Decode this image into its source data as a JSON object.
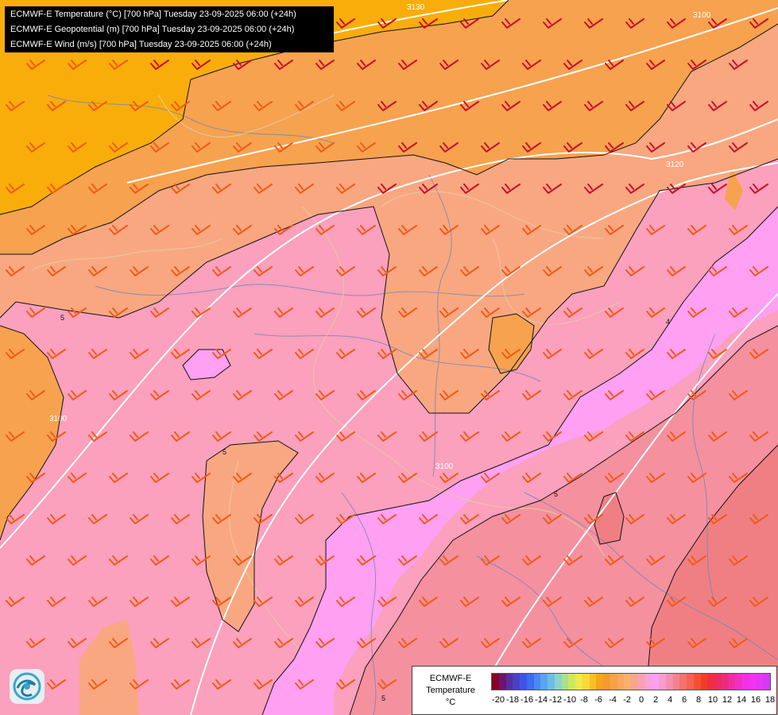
{
  "titles": [
    "ECMWF-E Temperature (°C) [700 hPa] Tuesday 23-09-2025 06:00 (+24h)",
    "ECMWF-E Geopotential (m) [700 hPa] Tuesday 23-09-2025 06:00 (+24h)",
    "ECMWF-E Wind (m/s) [700 hPa] Tuesday 23-09-2025 06:00 (+24h)"
  ],
  "legend": {
    "title_lines": [
      "ECMWF-E",
      "Temperature",
      "°C"
    ],
    "tick_labels": [
      "-20",
      "-18",
      "-16",
      "-14",
      "-12",
      "-10",
      "-8",
      "-6",
      "-4",
      "-2",
      "0",
      "2",
      "4",
      "6",
      "8",
      "10",
      "12",
      "14",
      "16",
      "18"
    ],
    "colors": [
      "#8b0026",
      "#6a1570",
      "#5a2d9e",
      "#4b3fc6",
      "#3c55e6",
      "#3a6df0",
      "#4a88f5",
      "#5aa3f5",
      "#6dbde8",
      "#8ad4c8",
      "#a9e08a",
      "#cde85c",
      "#efe94a",
      "#fbd93a",
      "#f9bf2a",
      "#f7a51a",
      "#f59a32",
      "#f7a246",
      "#f9a95a",
      "#f9b070",
      "#f7a58f",
      "#f9a0b6",
      "#fba2d6",
      "#ff9ef5",
      "#f89ccc",
      "#f58fae",
      "#f5818f",
      "#f57270",
      "#f76350",
      "#f45034",
      "#f23d26",
      "#ef2f40",
      "#ee2a60",
      "#ee2a80",
      "#f02ca4",
      "#f32ec4",
      "#f530e4",
      "#f133f2",
      "#e436f5",
      "#d438f8"
    ],
    "colors_note": "temperature color scale"
  },
  "geopotential_labels": [
    "3130",
    "3100",
    "3120",
    "3100",
    "3100"
  ],
  "isotherm_labels": [
    "5",
    "5",
    "4",
    "5",
    "5"
  ],
  "map_colors": {
    "orange_cold": "#f9ad0a",
    "orange": "#f7a24f",
    "salmon": "#f9a781",
    "pink_light": "#fba0bd",
    "pink": "#fda2d4",
    "magenta_light": "#ffa0f3",
    "warm_pink": "#f5909f",
    "warm_red": "#f07f84",
    "wind_barb": "#f25a16",
    "wind_barb_strong": "#c8102a",
    "isohypse": "#ffffff",
    "isotherm": "#111111"
  },
  "icons": {
    "logo": "ecmwf-swirl-logo",
    "wind": "wind-barb"
  }
}
